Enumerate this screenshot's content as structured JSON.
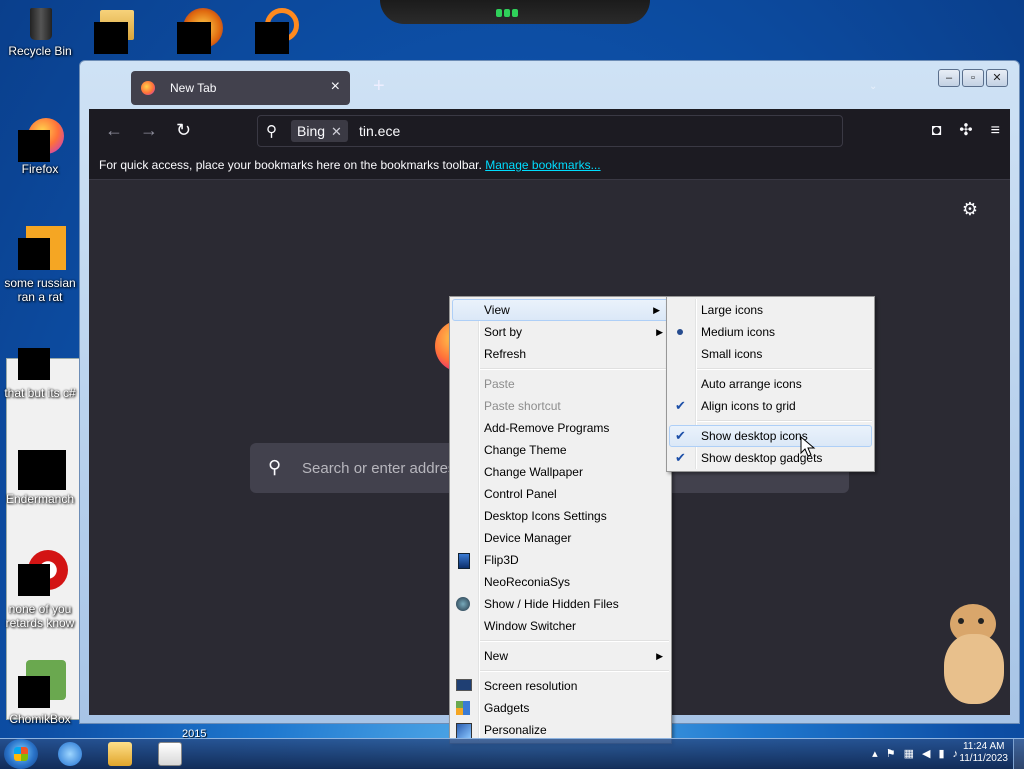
{
  "desktop": {
    "icons": [
      {
        "label": "Recycle Bin"
      },
      {
        "label": "Firefox"
      },
      {
        "label": "some russian ran a rat"
      },
      {
        "label": "that but its c#"
      },
      {
        "label": "Endermanch"
      },
      {
        "label": "none of you retards know"
      },
      {
        "label": "ChomikBox"
      }
    ],
    "year_label": "2015"
  },
  "browser": {
    "tab_title": "New Tab",
    "new_tab": "+",
    "url_engine": "Bing",
    "url_text": "tin.ece",
    "bookmarks_msg": "For quick access, place your bookmarks here on the bookmarks toolbar.",
    "bookmarks_link": "Manage bookmarks...",
    "search_placeholder": "Search or enter addres"
  },
  "context_menu": {
    "items": [
      {
        "label": "View"
      },
      {
        "label": "Sort by"
      },
      {
        "label": "Refresh"
      },
      {
        "label": "Paste"
      },
      {
        "label": "Paste shortcut"
      },
      {
        "label": "Add-Remove Programs"
      },
      {
        "label": "Change Theme"
      },
      {
        "label": "Change Wallpaper"
      },
      {
        "label": "Control Panel"
      },
      {
        "label": "Desktop Icons Settings"
      },
      {
        "label": "Device Manager"
      },
      {
        "label": "Flip3D"
      },
      {
        "label": "NeoReconiaSys"
      },
      {
        "label": "Show / Hide Hidden Files"
      },
      {
        "label": "Window Switcher"
      },
      {
        "label": "New"
      },
      {
        "label": "Screen resolution"
      },
      {
        "label": "Gadgets"
      },
      {
        "label": "Personalize"
      }
    ]
  },
  "view_submenu": {
    "items": [
      {
        "label": "Large icons"
      },
      {
        "label": "Medium icons"
      },
      {
        "label": "Small icons"
      },
      {
        "label": "Auto arrange icons"
      },
      {
        "label": "Align icons to grid"
      },
      {
        "label": "Show desktop icons"
      },
      {
        "label": "Show desktop gadgets"
      }
    ]
  },
  "taskbar": {
    "time": "11:24 AM",
    "date": "11/11/2023"
  },
  "colors": {
    "accent_link": "#00ddff",
    "browser_bg": "#2b2a33",
    "menu_bg": "#f0f0f0"
  }
}
